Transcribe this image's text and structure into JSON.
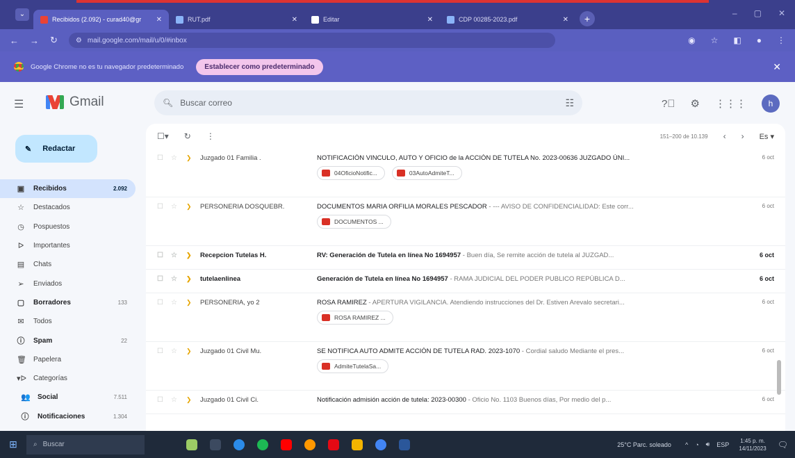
{
  "browser": {
    "tabs": [
      {
        "title": "Recibidos (2.092) - curad40@gr",
        "active": true,
        "color": "#ea4335"
      },
      {
        "title": "RUT.pdf",
        "active": false,
        "color": "#8ab4f8"
      },
      {
        "title": "Editar",
        "active": false,
        "color": "#ffffff"
      },
      {
        "title": "CDP 00285-2023.pdf",
        "active": false,
        "color": "#8ab4f8"
      }
    ],
    "url": "mail.google.com/mail/u/0/#inbox",
    "infobar_text": "Google Chrome no es tu navegador predeterminado",
    "infobar_button": "Establecer como predeterminado"
  },
  "gmail": {
    "logo_text": "Gmail",
    "search_placeholder": "Buscar correo",
    "avatar_letter": "h",
    "compose_label": "Redactar",
    "nav": [
      {
        "id": "recibidos",
        "label": "Recibidos",
        "count": "2.092",
        "icon": "▣",
        "active": true,
        "bold": true
      },
      {
        "id": "destacados",
        "label": "Destacados",
        "count": "",
        "icon": "☆"
      },
      {
        "id": "pospuestos",
        "label": "Pospuestos",
        "count": "",
        "icon": "◷"
      },
      {
        "id": "importantes",
        "label": "Importantes",
        "count": "",
        "icon": "ᐅ"
      },
      {
        "id": "chats",
        "label": "Chats",
        "count": "",
        "icon": "▤"
      },
      {
        "id": "enviados",
        "label": "Enviados",
        "count": "",
        "icon": "➢"
      },
      {
        "id": "borradores",
        "label": "Borradores",
        "count": "133",
        "icon": "▢",
        "bold": true
      },
      {
        "id": "todos",
        "label": "Todos",
        "count": "",
        "icon": "✉"
      },
      {
        "id": "spam",
        "label": "Spam",
        "count": "22",
        "icon": "ⓘ",
        "bold": true
      },
      {
        "id": "papelera",
        "label": "Papelera",
        "count": "",
        "icon": "🗑"
      },
      {
        "id": "categorias",
        "label": "Categorías",
        "count": "",
        "icon": "▾ᐅ"
      },
      {
        "id": "social",
        "label": "Social",
        "count": "7.511",
        "icon": "👥",
        "bold": true,
        "sub": true
      },
      {
        "id": "notificaciones",
        "label": "Notificaciones",
        "count": "1.304",
        "icon": "ⓘ",
        "bold": true,
        "sub": true
      }
    ],
    "pager": "151–200 de 10.139",
    "lang": "Es ▾",
    "emails": [
      {
        "sender": "Juzgado 01 Familia .",
        "subject": "NOTIFICACIÓN VINCULO, AUTO Y OFICIO de la ACCIÓN DE TUTELA No. 2023-00636 JUZGADO ÚNI...",
        "snippet": "",
        "date": "6 oct",
        "unread": false,
        "attachments": [
          "04OficioNotific...",
          "03AutoAdmiteT..."
        ]
      },
      {
        "sender": "PERSONERIA DOSQUEBR.",
        "subject": "DOCUMENTOS MARIA ORFILIA MORALES PESCADOR",
        "snippet": " - --- AVISO DE CONFIDENCIALIDAD: Este corr...",
        "date": "6 oct",
        "unread": false,
        "attachments": [
          "DOCUMENTOS ..."
        ]
      },
      {
        "sender": "Recepcion Tutelas H.",
        "subject": "RV: Generación de Tutela en línea No 1694957",
        "snippet": " - Buen día, Se remite acción de tutela al JUZGAD...",
        "date": "6 oct",
        "unread": true,
        "attachments": []
      },
      {
        "sender": "tutelaenlinea",
        "subject": "Generación de Tutela en línea No 1694957",
        "snippet": " - RAMA JUDICIAL DEL PODER PUBLICO REPÚBLICA D...",
        "date": "6 oct",
        "unread": true,
        "attachments": []
      },
      {
        "sender": "PERSONERIA, yo 2",
        "subject": "ROSA RAMIREZ",
        "snippet": " - APERTURA VIGILANCIA. Atendiendo instrucciones del Dr. Estiven Arevalo secretari...",
        "date": "6 oct",
        "unread": false,
        "attachments": [
          "ROSA RAMIREZ ..."
        ]
      },
      {
        "sender": "Juzgado 01 Civil Mu.",
        "subject": "SE NOTIFICA AUTO ADMITE ACCIÓN DE TUTELA RAD. 2023-1070",
        "snippet": " - Cordial saludo Mediante el pres...",
        "date": "6 oct",
        "unread": false,
        "attachments": [
          "AdmiteTutelaSa..."
        ]
      },
      {
        "sender": "Juzgado 01 Civil Ci.",
        "subject": "Notificación admisión acción de tutela: 2023-00300",
        "snippet": " - Oficio No. 1103 Buenos días, Por medio del p...",
        "date": "6 oct",
        "unread": false,
        "attachments": []
      }
    ]
  },
  "taskbar": {
    "search": "Buscar",
    "weather": "25°C Parc. soleado",
    "lang": "ESP",
    "time": "1:45 p. m.",
    "date": "14/11/2023"
  }
}
